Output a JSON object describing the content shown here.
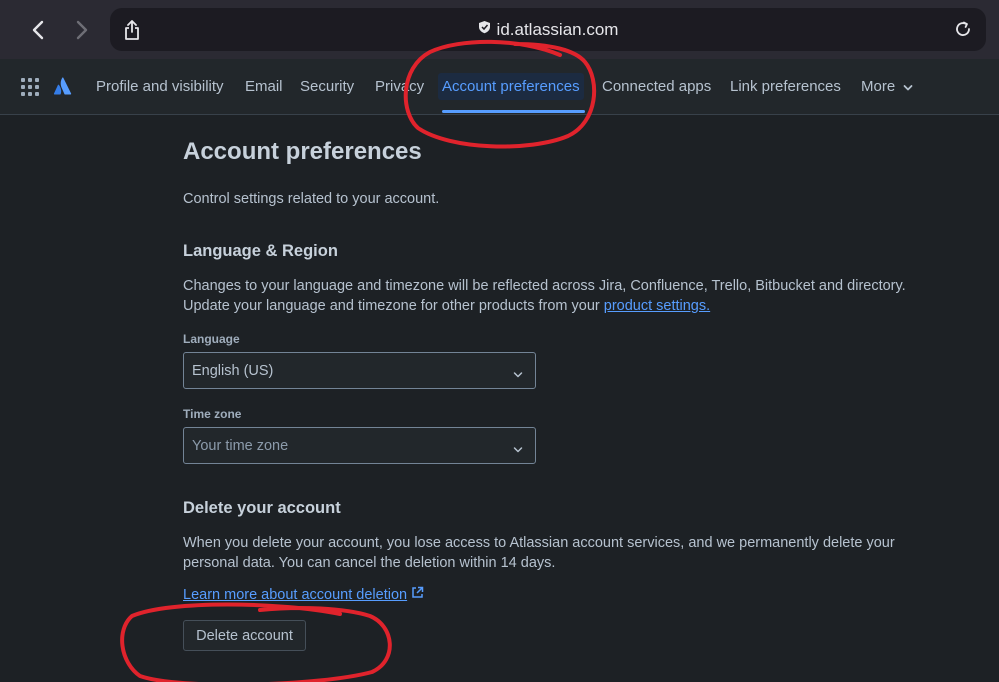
{
  "browser": {
    "url": "id.atlassian.com"
  },
  "nav": {
    "tabs": [
      {
        "label": "Profile and visibility"
      },
      {
        "label": "Email"
      },
      {
        "label": "Security"
      },
      {
        "label": "Privacy"
      },
      {
        "label": "Account preferences",
        "active": true
      },
      {
        "label": "Connected apps"
      },
      {
        "label": "Link preferences"
      },
      {
        "label": "More"
      }
    ]
  },
  "page": {
    "title": "Account preferences",
    "subtitle": "Control settings related to your account."
  },
  "language_region": {
    "heading": "Language & Region",
    "description": "Changes to your language and timezone will be reflected across Jira, Confluence, Trello, Bitbucket and directory. Update your language and timezone for other products from your",
    "link": "product settings.",
    "language_label": "Language",
    "language_value": "English (US)",
    "timezone_label": "Time zone",
    "timezone_placeholder": "Your time zone"
  },
  "delete": {
    "heading": "Delete your account",
    "description": "When you delete your account, you lose access to Atlassian account services, and we permanently delete your personal data. You can cancel the deletion within 14 days.",
    "learn_more": "Learn more about account deletion",
    "button": "Delete account"
  },
  "colors": {
    "accent": "#579dff",
    "background": "#1d2125",
    "annotation": "#e0232c"
  }
}
